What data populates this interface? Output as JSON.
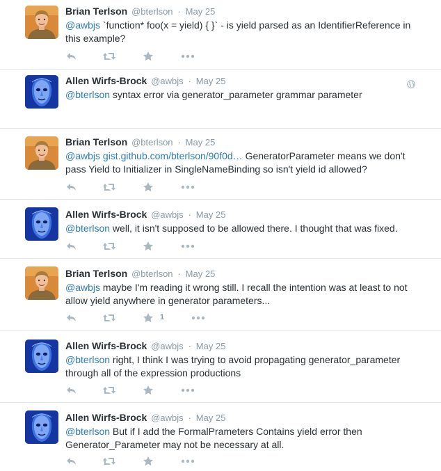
{
  "tweets": [
    {
      "author": "brian",
      "name": "Brian Terlson",
      "handle": "@bterlson",
      "time": "May 25",
      "mention": "@awbjs",
      "text": " `function* foo(x = yield) { }` - is yield parsed as an IdentifierReference in this example?"
    },
    {
      "author": "allen",
      "name": "Allen Wirfs-Brock",
      "handle": "@awbjs",
      "time": "May 25",
      "mention": "@bterlson",
      "text": " syntax error via generator_parameter grammar parameter"
    },
    {
      "author": "brian",
      "name": "Brian Terlson",
      "handle": "@bterlson",
      "time": "May 25",
      "mention": "@awbjs",
      "link": "gist.github.com/bterlson/90f0d…",
      "text": " GeneratorParameter means we don't pass Yield to Initializer in SingleNameBinding so isn't yield id allowed?"
    },
    {
      "author": "allen",
      "name": "Allen Wirfs-Brock",
      "handle": "@awbjs",
      "time": "May 25",
      "mention": "@bterlson",
      "text": " well, it isn't supposed to be allowed there. I thought that was fixed."
    },
    {
      "author": "brian",
      "name": "Brian Terlson",
      "handle": "@bterlson",
      "time": "May 25",
      "mention": "@awbjs",
      "text": " maybe I'm reading it wrong still. I recall the intention was at least to not allow yield anywhere in generator parameters...",
      "favorite_count": "1"
    },
    {
      "author": "allen",
      "name": "Allen Wirfs-Brock",
      "handle": "@awbjs",
      "time": "May 25",
      "mention": "@bterlson",
      "text": " right, I think I was trying to avoid propagating generator_parameter through all of the expression productions"
    },
    {
      "author": "allen",
      "name": "Allen Wirfs-Brock",
      "handle": "@awbjs",
      "time": "May 25",
      "mention": "@bterlson",
      "text": " But if I add the FormalPrameters Contains yield error then Generator_Parameter may not be necessary at all."
    }
  ],
  "icons": {
    "reply": "reply-icon",
    "retweet": "retweet-icon",
    "favorite": "favorite-star-icon",
    "more": "more-icon",
    "globe": "globe-icon"
  },
  "colors": {
    "link": "#2b7bb9",
    "meta": "#8899a6",
    "action_icon": "#aab8c2",
    "divider": "#e1e8ed"
  }
}
